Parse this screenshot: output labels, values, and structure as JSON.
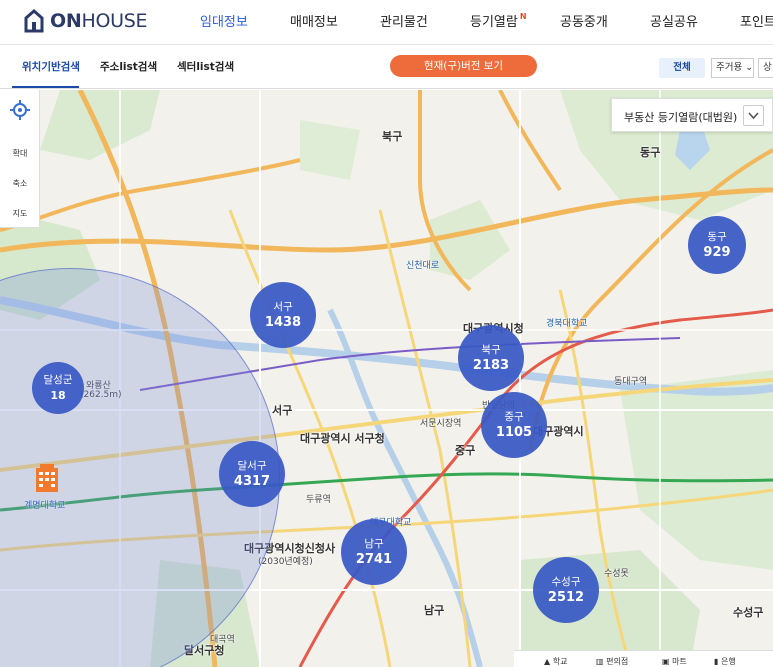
{
  "brand": {
    "name_bold": "ON",
    "name_rest": "HOUSE"
  },
  "nav": {
    "items": [
      {
        "label": "임대정보",
        "active": true
      },
      {
        "label": "매매정보",
        "active": false
      },
      {
        "label": "관리물건",
        "active": false
      },
      {
        "label": "등기열람",
        "active": false,
        "badge": "N"
      },
      {
        "label": "공동중개",
        "active": false
      },
      {
        "label": "공실공유",
        "active": false
      },
      {
        "label": "포인트",
        "active": false
      }
    ]
  },
  "subtabs": [
    {
      "label": "위치기반검색",
      "active": true
    },
    {
      "label": "주소list검색",
      "active": false
    },
    {
      "label": "섹터list검색",
      "active": false
    }
  ],
  "old_version_button": "현재(구)버전 보기",
  "filters": {
    "all": "전체",
    "type_select": "주거용",
    "type_arrow": "⌄",
    "next_select": "상"
  },
  "map_controls": {
    "zoom_in": "확대",
    "zoom_out": "축소",
    "map": "지도"
  },
  "register_box": {
    "label": "부동산 등기열람(대법원)",
    "button_icon": "chevron-down-icon"
  },
  "clusters": [
    {
      "name": "서구",
      "count": "1438"
    },
    {
      "name": "북구",
      "count": "2183"
    },
    {
      "name": "동구",
      "count": "929"
    },
    {
      "name": "달성군",
      "count": "18"
    },
    {
      "name": "중구",
      "count": "1105"
    },
    {
      "name": "달서구",
      "count": "4317"
    },
    {
      "name": "남구",
      "count": "2741"
    },
    {
      "name": "수성구",
      "count": "2512"
    }
  ],
  "map_labels": {
    "buk_gu": "북구",
    "dong_gu": "동구",
    "seo_gu": "서구",
    "jung_gu": "중구",
    "nam_gu": "남구",
    "suseong_gu": "수성구",
    "daegu_city_hall": "대구광역시청",
    "daegu_seogu_office": "대구광역시\n서구청",
    "daegu_new_hall": "대구광역시청신청사",
    "daegu_new_hall_note": "(2030년예정)",
    "jung_gu_office": "대구광역시",
    "dalseo_gu_office": "달서구청",
    "sindong_road": "신천대로",
    "waryong": "와룡산",
    "waryong_elev": "(262.5m)",
    "kyungpook": "경북대학교",
    "keimyung": "계명대학교",
    "daegu_univ": "대구대학교",
    "suseong_lake": "수성못",
    "dongdaegu": "동대구역",
    "banwoldang": "반월당역",
    "seomun": "서문시장역",
    "duryu": "두류역",
    "daegok": "대곡역"
  },
  "legend": [
    "학교",
    "편의점",
    "마트",
    "은행"
  ]
}
